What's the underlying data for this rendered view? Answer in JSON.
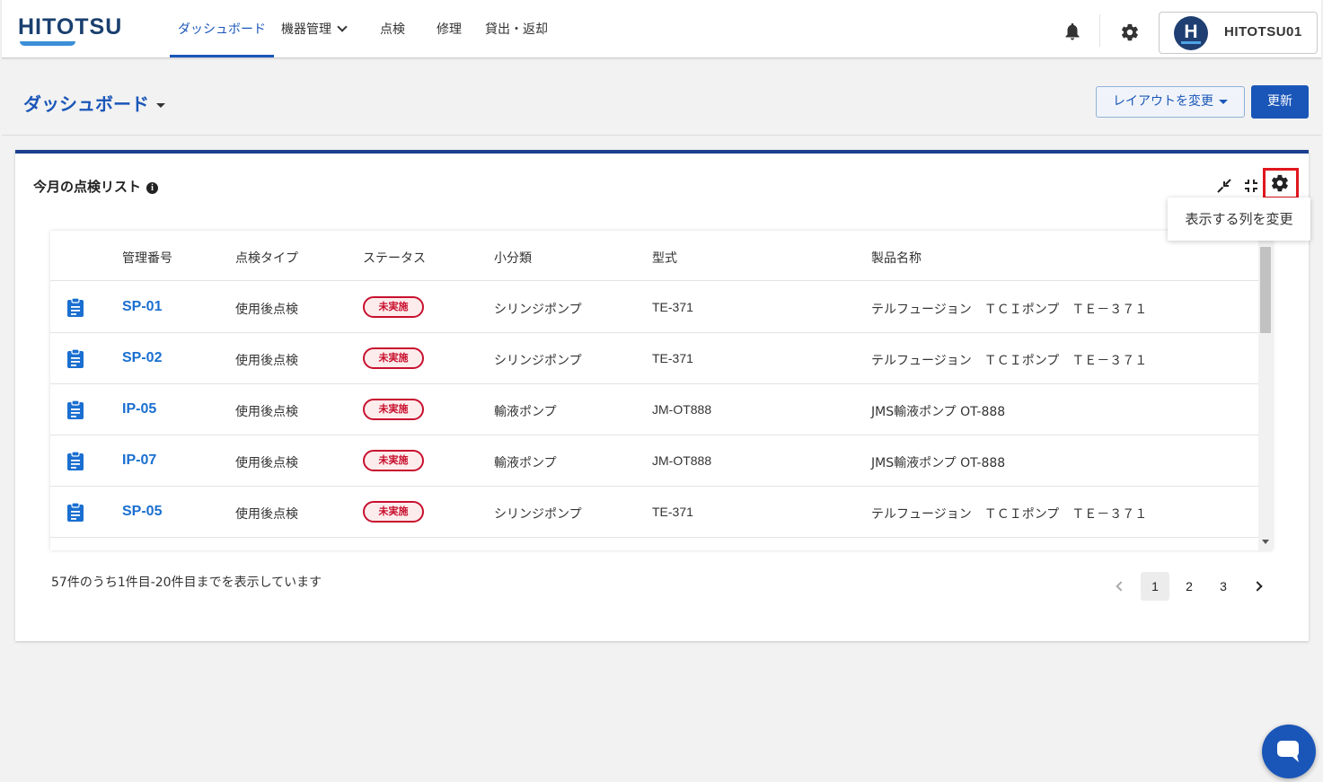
{
  "header": {
    "logo": "HITOTSU",
    "nav": [
      {
        "label": "ダッシュボード",
        "active": true
      },
      {
        "label": "機器管理",
        "dropdown": true
      },
      {
        "label": "点検"
      },
      {
        "label": "修理"
      },
      {
        "label": "貸出・返却"
      }
    ],
    "user": {
      "initial": "H",
      "name": "HITOTSU01"
    }
  },
  "page": {
    "title": "ダッシュボード",
    "layout_button": "レイアウトを変更",
    "refresh_button": "更新"
  },
  "card": {
    "title": "今月の点検リスト",
    "tooltip": "表示する列を変更",
    "columns": [
      "管理番号",
      "点検タイプ",
      "ステータス",
      "小分類",
      "型式",
      "製品名称"
    ],
    "rows": [
      {
        "id": "SP-01",
        "type": "使用後点検",
        "status": "未実施",
        "category": "シリンジポンプ",
        "model": "TE-371",
        "product": "テルフュージョン　ＴＣＩポンプ　ＴＥ－３７１"
      },
      {
        "id": "SP-02",
        "type": "使用後点検",
        "status": "未実施",
        "category": "シリンジポンプ",
        "model": "TE-371",
        "product": "テルフュージョン　ＴＣＩポンプ　ＴＥ－３７１"
      },
      {
        "id": "IP-05",
        "type": "使用後点検",
        "status": "未実施",
        "category": "輸液ポンプ",
        "model": "JM-OT888",
        "product": "JMS輸液ポンプ OT-888"
      },
      {
        "id": "IP-07",
        "type": "使用後点検",
        "status": "未実施",
        "category": "輸液ポンプ",
        "model": "JM-OT888",
        "product": "JMS輸液ポンプ OT-888"
      },
      {
        "id": "SP-05",
        "type": "使用後点検",
        "status": "未実施",
        "category": "シリンジポンプ",
        "model": "TE-371",
        "product": "テルフュージョン　ＴＣＩポンプ　ＴＥ－３７１"
      }
    ],
    "summary": "57件のうち1件目-20件目までを表示しています",
    "pagination": {
      "pages": [
        "1",
        "2",
        "3"
      ],
      "current": "1"
    }
  },
  "colors": {
    "primary": "#1a56b8",
    "badge": "#c8102e",
    "highlight": "#e0161e"
  }
}
